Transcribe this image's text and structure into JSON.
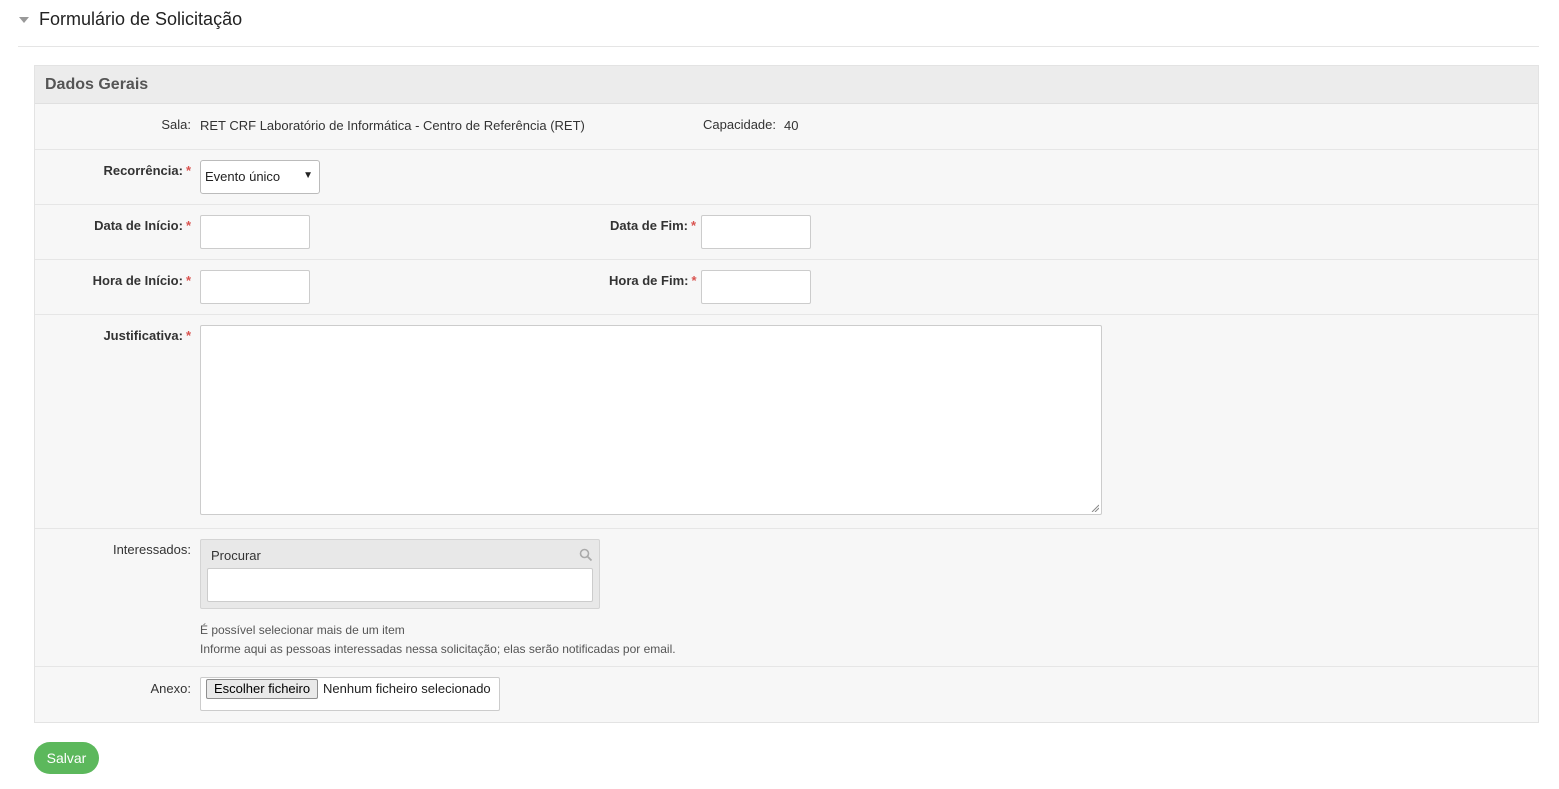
{
  "header": {
    "title": "Formulário de Solicitação"
  },
  "panel": {
    "title": "Dados Gerais"
  },
  "form": {
    "sala": {
      "label": "Sala:",
      "value": "RET CRF Laboratório de Informática - Centro de Referência (RET)"
    },
    "capacidade": {
      "label": "Capacidade:",
      "value": "40"
    },
    "recorrencia": {
      "label": "Recorrência:",
      "selected": "Evento único"
    },
    "data_inicio": {
      "label": "Data de Início:",
      "value": ""
    },
    "data_fim": {
      "label": "Data de Fim:",
      "value": ""
    },
    "hora_inicio": {
      "label": "Hora de Início:",
      "value": ""
    },
    "hora_fim": {
      "label": "Hora de Fim:",
      "value": ""
    },
    "justificativa": {
      "label": "Justificativa:",
      "value": ""
    },
    "interessados": {
      "label": "Interessados:",
      "search_label": "Procurar",
      "value": "",
      "help1": "É possível selecionar mais de um item",
      "help2": "Informe aqui as pessoas interessadas nessa solicitação; elas serão notificadas por email."
    },
    "anexo": {
      "label": "Anexo:",
      "button": "Escolher ficheiro",
      "status": "Nenhum ficheiro selecionado"
    },
    "required_mark": "*"
  },
  "actions": {
    "save": "Salvar"
  },
  "colors": {
    "save_button": "#5cb85c",
    "required": "#d9534f"
  }
}
